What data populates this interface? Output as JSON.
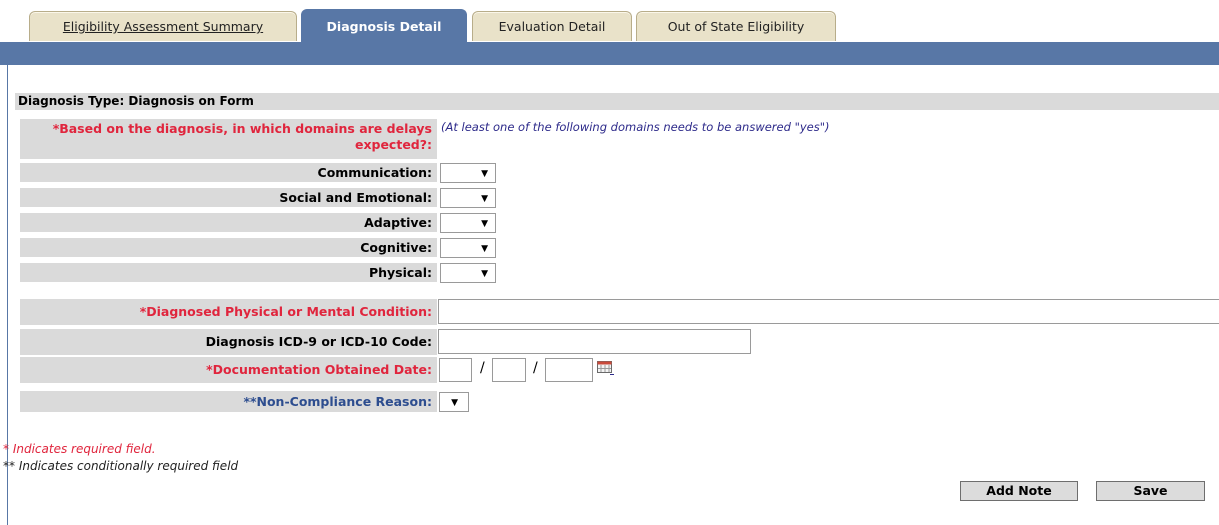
{
  "tabs": [
    {
      "label": "Eligibility Assessment Summary"
    },
    {
      "label": "Diagnosis Detail"
    },
    {
      "label": "Evaluation Detail"
    },
    {
      "label": "Out of State Eligibility"
    }
  ],
  "diagnosis_type": "Diagnosis Type:  Diagnosis on Form",
  "domains_question": "*Based on the diagnosis, in which domains are delays expected?:",
  "domains_hint": "(At least one of the following domains needs to be answered \"yes\")",
  "domains": [
    {
      "label": "Communication:",
      "value": ""
    },
    {
      "label": "Social and Emotional:",
      "value": ""
    },
    {
      "label": "Adaptive:",
      "value": ""
    },
    {
      "label": "Cognitive:",
      "value": ""
    },
    {
      "label": "Physical:",
      "value": ""
    }
  ],
  "condition_label": "*Diagnosed Physical or Mental Condition:",
  "condition_value": "",
  "icd_label": "Diagnosis ICD-9 or ICD-10 Code:",
  "icd_value": "",
  "doc_date_label": "*Documentation Obtained Date:",
  "doc_date": {
    "month": "",
    "day": "",
    "year": "",
    "separator": "/"
  },
  "noncompliance_label": "**Non-Compliance Reason:",
  "noncompliance_value": "",
  "dropdown_arrow": "▼",
  "required_note": "* Indicates required field.",
  "conditional_note": "** Indicates conditionally required field",
  "buttons": {
    "add_note": "Add Note",
    "save": "Save"
  },
  "colors": {
    "bar": "#5877a6",
    "required": "#e0253d",
    "conditional": "#2d4d8f",
    "row_bg": "#dadada",
    "tab": "#e9e2c9"
  },
  "icons": {
    "calendar": "calendar-icon"
  }
}
